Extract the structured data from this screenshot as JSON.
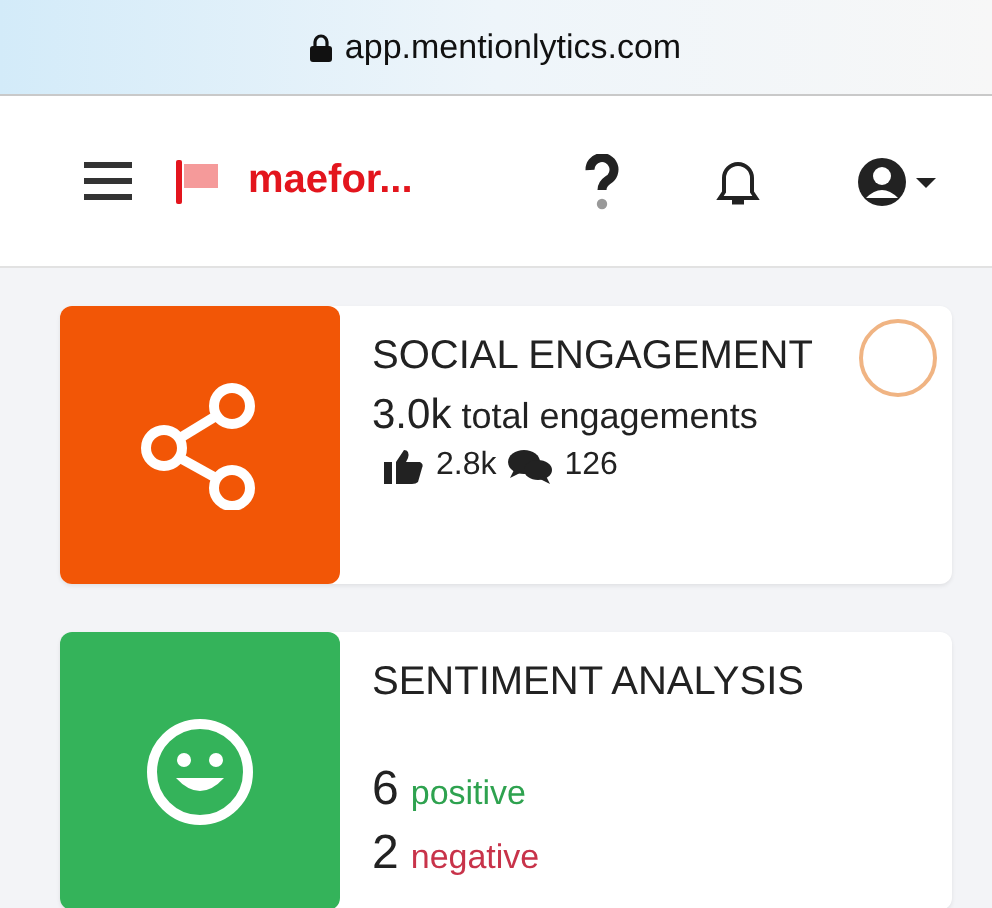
{
  "address_bar": {
    "url": "app.mentionlytics.com"
  },
  "header": {
    "project": "maefor..."
  },
  "cards": [
    {
      "kind": "engagement",
      "color": "#f25606",
      "title": "SOCIAL ENGAGEMENT",
      "total": "3.0k",
      "total_label": "total engagements",
      "likes": "2.8k",
      "comments": "126"
    },
    {
      "kind": "sentiment",
      "color": "#34b35a",
      "title": "SENTIMENT ANALYSIS",
      "positive": "6",
      "positive_label": "positive",
      "negative": "2",
      "negative_label": "negative"
    }
  ]
}
